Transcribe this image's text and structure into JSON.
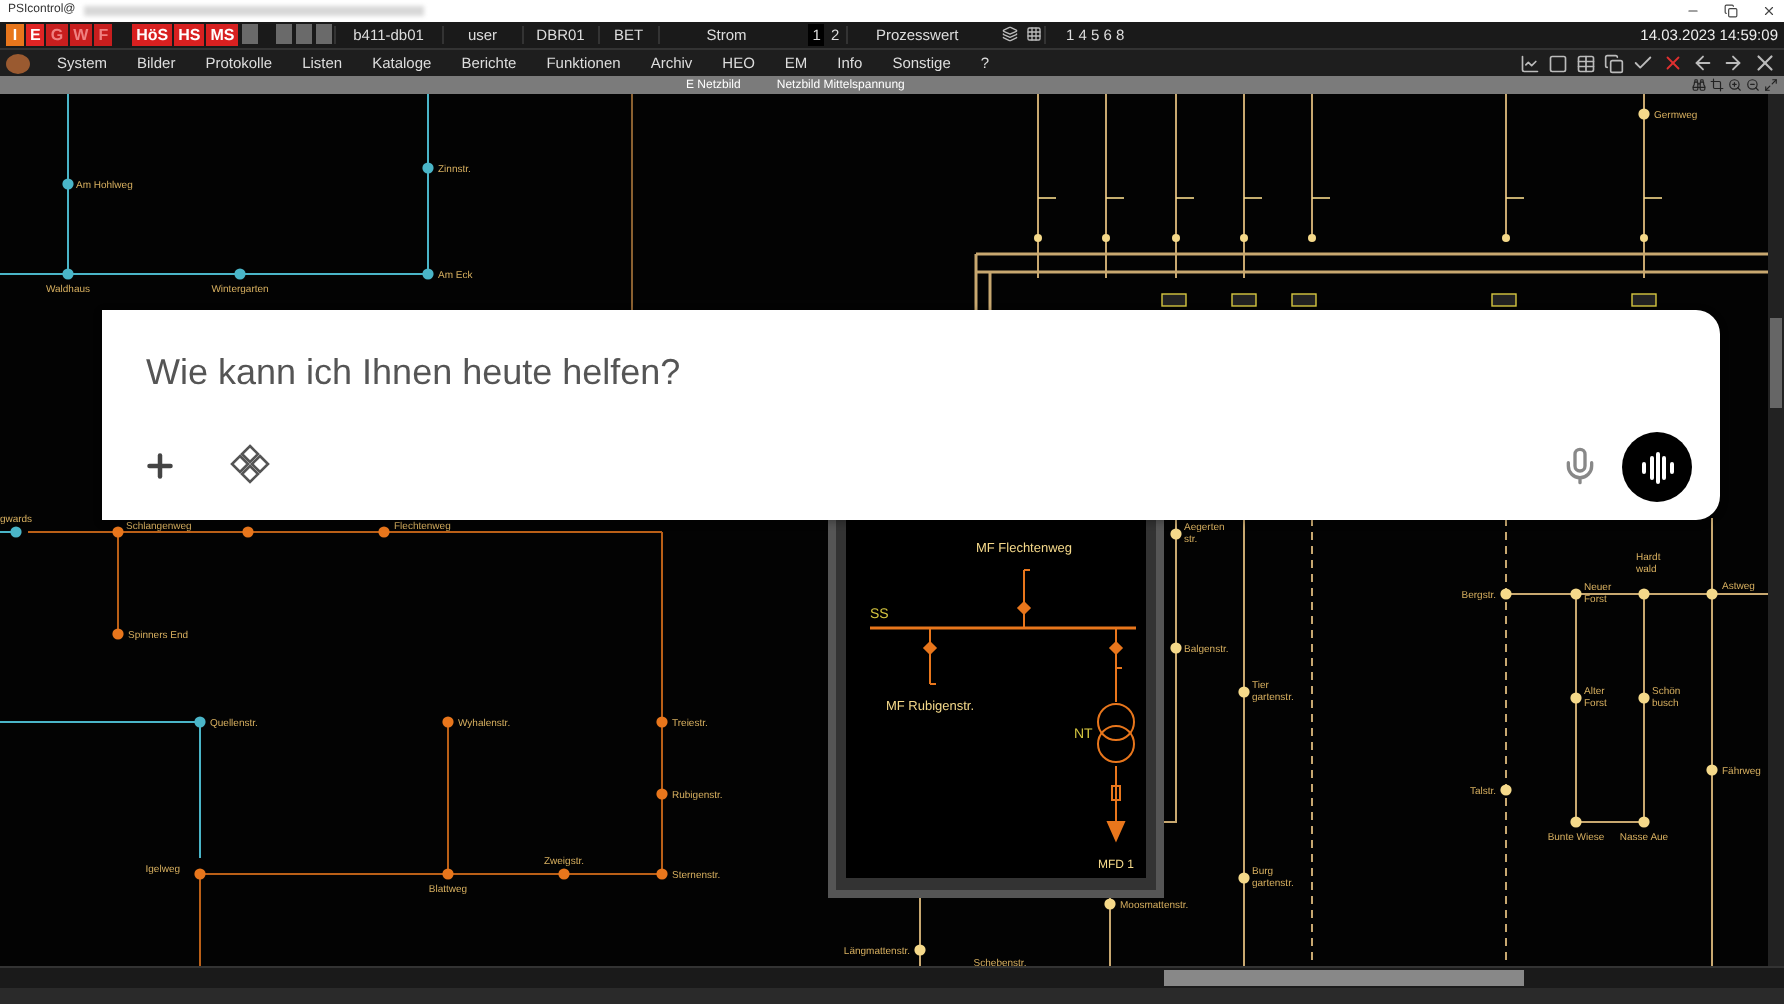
{
  "window": {
    "title": "PSIcontrol@"
  },
  "status_bar": {
    "alarms": [
      {
        "label": "I",
        "color": "#e8761c"
      },
      {
        "label": "E",
        "color": "#e02424"
      },
      {
        "label": "G",
        "color": "#c81e1e"
      },
      {
        "label": "W",
        "color": "#c81e1e"
      },
      {
        "label": "F",
        "color": "#c81e1e"
      }
    ],
    "levels": [
      "HöS",
      "HS",
      "MS"
    ],
    "fields": [
      "b411-db01",
      "user",
      "DBR01",
      "BET",
      "Strom"
    ],
    "pages": [
      {
        "label": "1",
        "selected": true
      },
      {
        "label": "2",
        "selected": false
      }
    ],
    "mode": "Prozesswert",
    "layers": "1 4 5 6 8",
    "datetime": "14.03.2023 14:59:09"
  },
  "menu": [
    "System",
    "Bilder",
    "Protokolle",
    "Listen",
    "Kataloge",
    "Berichte",
    "Funktionen",
    "Archiv",
    "HEO",
    "EM",
    "Info",
    "Sonstige",
    "?"
  ],
  "breadcrumb": [
    "E Netzbild",
    "Netzbild Mittelspannung"
  ],
  "diagram": {
    "blue_nodes": [
      "Am Hohlweg",
      "Zinnstr.",
      "Waldhaus",
      "Wintergarten",
      "Am Eck",
      "Quellenstr.",
      "gwards"
    ],
    "orange_nodes": [
      "Schlangenweg",
      "Flechtenweg",
      "Spinners End",
      "Wyhalenstr.",
      "Treiestr.",
      "Rubigenstr.",
      "Igelweg",
      "Blattweg",
      "Zweigstr.",
      "Sternenstr."
    ],
    "station": {
      "incoming": "MF Flechtenweg",
      "busbar": "SS",
      "outgoing": "MF Rubigenstr.",
      "transformer": "NT",
      "feeder": "MFD 1"
    },
    "yellow_nodes": [
      "Germweg",
      "Aegerten str.",
      "Balgenstr.",
      "Tier gartenstr.",
      "Burg gartenstr.",
      "Moosmattenstr.",
      "Längmattenstr.",
      "Schebenstr.",
      "Bergstr.",
      "Neuer Forst",
      "Hardt wald",
      "Astweg",
      "Alter Forst",
      "Schön busch",
      "Talstr.",
      "Fährweg",
      "Bunte Wiese",
      "Nasse Aue"
    ]
  },
  "chat": {
    "placeholder": "Wie kann ich Ihnen heute helfen?"
  }
}
